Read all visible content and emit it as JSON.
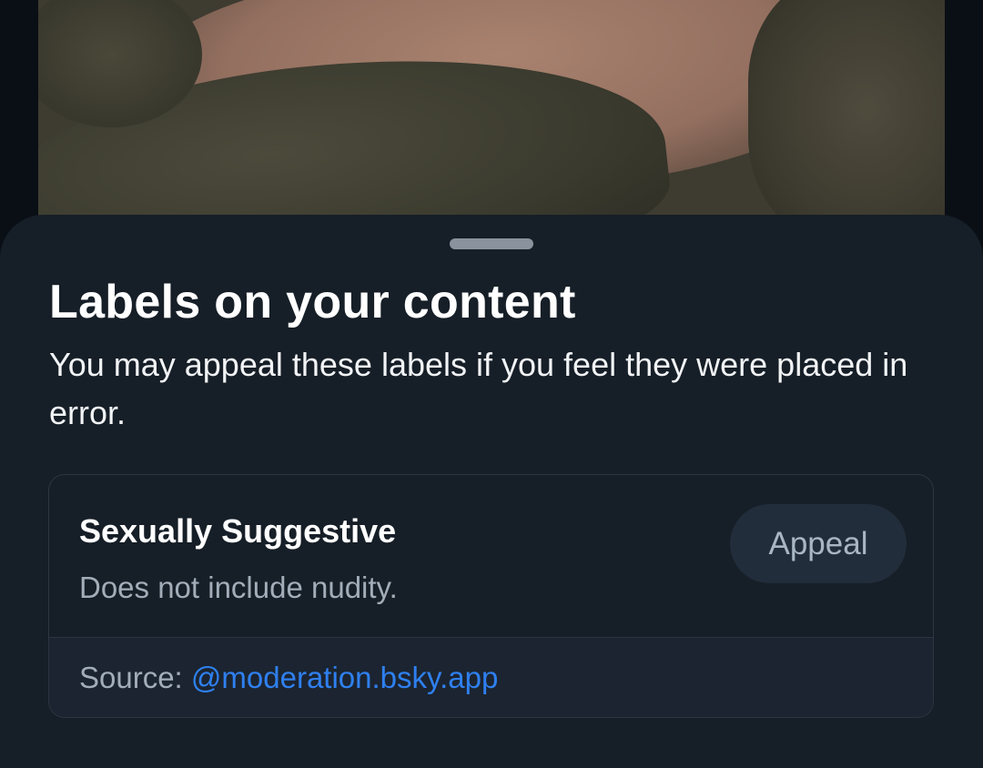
{
  "sheet": {
    "title": "Labels on your content",
    "subtitle": "You may appeal these labels if you feel they were placed in error."
  },
  "labels": [
    {
      "name": "Sexually Suggestive",
      "description": "Does not include nudity.",
      "appeal_label": "Appeal",
      "source_prefix": "Source: ",
      "source_handle": "@moderation.bsky.app"
    }
  ],
  "colors": {
    "sheet_background": "#161e27",
    "link": "#2f80f0",
    "appeal_button_bg": "#222d3b"
  }
}
